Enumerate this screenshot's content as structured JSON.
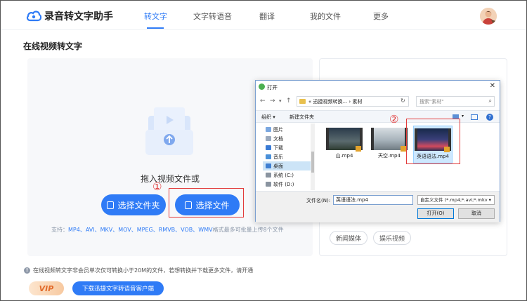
{
  "app": {
    "title": "录音转文字助手"
  },
  "nav": {
    "items": [
      {
        "label": "转文字",
        "active": true
      },
      {
        "label": "文字转语音",
        "active": false
      },
      {
        "label": "翻译",
        "active": false
      },
      {
        "label": "我的文件",
        "active": false
      },
      {
        "label": "更多",
        "active": false
      }
    ]
  },
  "page": {
    "title": "在线视频转文字"
  },
  "drop": {
    "prompt": "拖入视频文件或",
    "select_folder": "选择文件夹",
    "select_file": "选择文件",
    "support_prefix": "支持：",
    "support_formats": "MP4、AVI、MKV、MOV、MPEG、RMVB、VOB、WMV",
    "support_suffix": "格式最多可批量上传8个文件"
  },
  "right_panel": {
    "tags": [
      "新闻媒体",
      "娱乐视频"
    ]
  },
  "annotations": {
    "one": "①",
    "two": "②"
  },
  "notice": {
    "text": "在线视频转文字非会员单次仅可转换小于20M的文件，若想转换并下载更多文件，请开通"
  },
  "bottom": {
    "vip": "VIP",
    "download": "下载迅捷文字转语音客户端"
  },
  "dialog": {
    "title": "打开",
    "path_prefix": "«",
    "path": "迅捷视频转换... › 素材",
    "search_placeholder": "搜索\"素材\"",
    "toolbar_organize": "组织 ▾",
    "toolbar_new_folder": "新建文件夹",
    "tree": [
      "图片",
      "文档",
      "下载",
      "音乐",
      "桌面",
      "系统 (C:)",
      "软件 (D:)"
    ],
    "selected_tree": "桌面",
    "files": [
      {
        "name": "山.mp4",
        "theme": "mountain"
      },
      {
        "name": "天空.mp4",
        "theme": "sky"
      },
      {
        "name": "英语语法.mp4",
        "theme": "city"
      }
    ],
    "selected_file": "英语语法.mp4",
    "filename_label": "文件名(N):",
    "filename_value": "英语语法.mp4",
    "filter": "自定义文件 (*.mp4;*.avi;*.mkv",
    "open_button": "打开(O)",
    "cancel_button": "取消"
  },
  "colors": {
    "accent": "#2f7bf6",
    "annotation": "#e23b3b"
  }
}
